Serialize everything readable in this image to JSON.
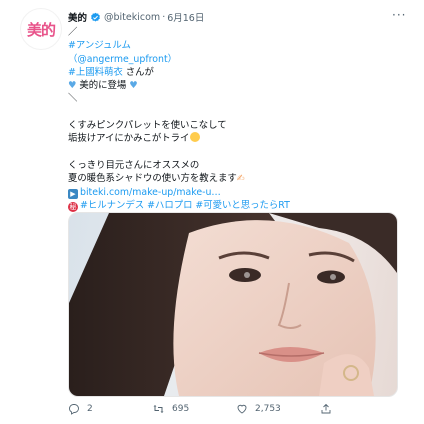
{
  "tweet": {
    "avatar_text": "美的",
    "author_name": "美的",
    "handle": "@bitekicom",
    "separator": "·",
    "date": "6月16日",
    "more_label": "···",
    "lines": {
      "l1": "／",
      "l2": "#アンジュルム",
      "l3": "（@angerme_upfront）",
      "l4_tag": "#上國料萌衣",
      "l4_rest": " さんが",
      "l5": "美的に登場",
      "l6": "＼",
      "l8": "くすみピンクパレットを使いこなして",
      "l9": "垢抜けアイにかみこがトライ",
      "l11": "くっきり目元さんにオススメの",
      "l12": "夏の暖色系シャドウの使い方を教えます",
      "l13_link": "biteki.com/make-up/make-u…",
      "l14_tags": "#ヒルナンデス #ハロプロ #可愛いと思ったらRT"
    },
    "emoji": {
      "heart": "heart-icon",
      "smile": "smiling-face-icon",
      "pencil": "writing-hand-icon",
      "play": "play-button-icon",
      "secret": "secret-ideograph-icon"
    }
  },
  "actions": {
    "reply_count": "2",
    "retweet_count": "695",
    "like_count": "2,753"
  },
  "colors": {
    "link": "#1d9bf0",
    "text": "#0f1419",
    "muted": "#536471",
    "brand": "#e8538a"
  }
}
